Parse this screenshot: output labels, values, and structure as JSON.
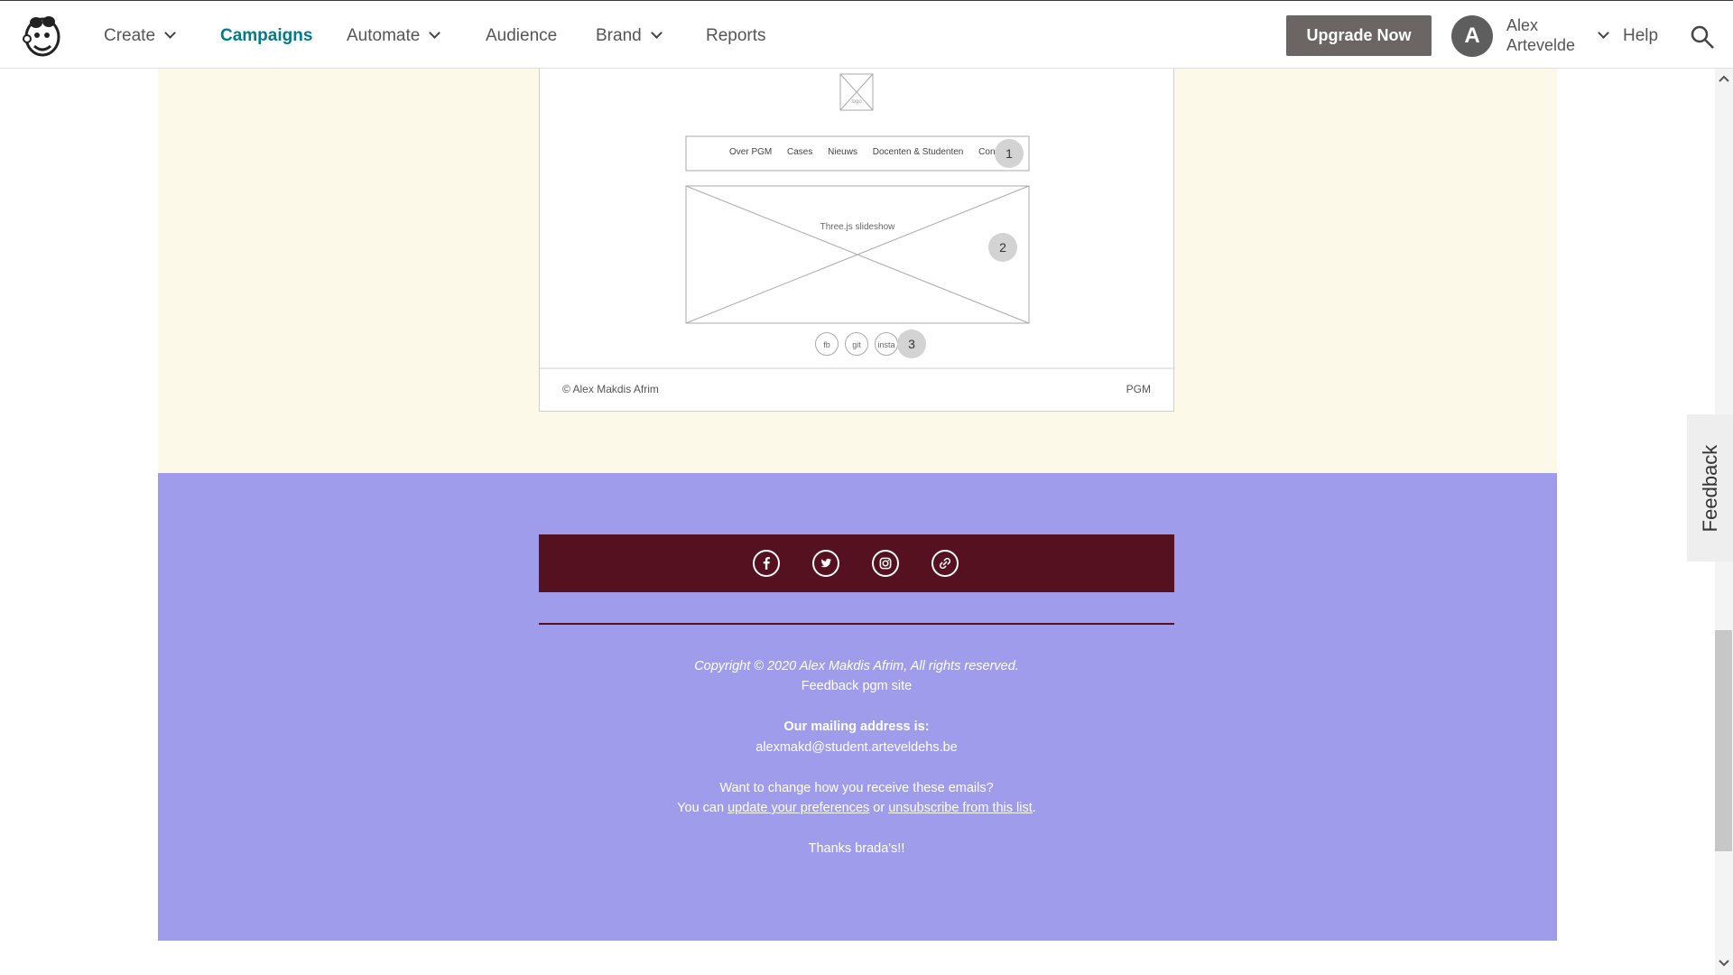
{
  "nav": {
    "create": "Create",
    "campaigns": "Campaigns",
    "automate": "Automate",
    "audience": "Audience",
    "brand": "Brand",
    "reports": "Reports",
    "upgrade": "Upgrade Now",
    "avatar_initial": "A",
    "user_first": "Alex",
    "user_last": "Artevelde",
    "help": "Help",
    "icons": [
      "mailchimp-logo-icon",
      "chevron-down-icon",
      "search-icon"
    ]
  },
  "wireframe": {
    "logo_label": "logo",
    "menu": [
      "Over PGM",
      "Cases",
      "Nieuws",
      "Docenten & Studenten",
      "Contact"
    ],
    "badge1": "1",
    "slideshow_label": "Three.js slideshow",
    "badge2": "2",
    "social": [
      "fb",
      "git",
      "insta"
    ],
    "badge3": "3",
    "footer_left": "© Alex Makdis Afrim",
    "footer_right": "PGM"
  },
  "social_icons": [
    "facebook-icon",
    "twitter-icon",
    "instagram-icon",
    "link-icon"
  ],
  "footer": {
    "copyright": "Copyright © 2020 Alex Makdis Afrim, All rights reserved.",
    "tagline": "Feedback pgm site",
    "mailing_heading": "Our mailing address is:",
    "email": "alexmakd@student.arteveldehs.be",
    "change_question": "Want to change how you receive these emails?",
    "you_can": "You can ",
    "update_link": "update your preferences",
    "or": " or ",
    "unsubscribe_link": "unsubscribe from this list",
    "period": ".",
    "thanks": "Thanks brada's!!"
  },
  "feedback_tab": "Feedback",
  "colors": {
    "brand_teal": "#007c89",
    "cream_bg": "#fcf9e8",
    "purple_bg": "#9f9deb",
    "social_bar": "#561120",
    "upgrade_btn": "#6b6563"
  }
}
